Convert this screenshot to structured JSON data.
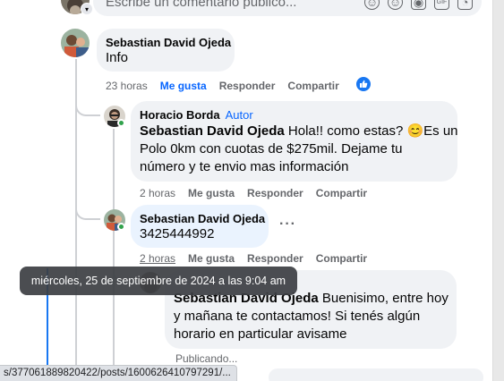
{
  "composer": {
    "placeholder": "Escribe un comentario público..."
  },
  "comments": [
    {
      "author": "Sebastian David Ojeda",
      "text": "Info",
      "time": "23 horas",
      "like_label": "Me gusta",
      "reply_label": "Responder",
      "share_label": "Compartir"
    },
    {
      "author": "Horacio Borda",
      "author_badge": "Autor",
      "mention": "Sebastian David Ojeda",
      "text_l1": " Hola!! como estas? ",
      "emoji": "😊",
      "text_l1b": "Es un",
      "text_l2": "Polo 0km con cuotas de $275mil. Dejame tu",
      "text_l3": "número y te envio mas información",
      "time": "2 horas",
      "like_label": "Me gusta",
      "reply_label": "Responder",
      "share_label": "Compartir"
    },
    {
      "author": "Sebastian David Ojeda",
      "text": "3425444992",
      "time": "2 horas",
      "like_label": "Me gusta",
      "reply_label": "Responder",
      "share_label": "Compartir"
    },
    {
      "mention": "Sebastian David Ojeda",
      "text_l1": " Buenisimo, entre hoy",
      "text_l2": "y mañana te contactamos! Si tenés algún",
      "text_l3": "horario en particular avisame",
      "status": "Publicando..."
    }
  ],
  "tooltip": "miércoles, 25 de septiembre de 2024 a las 9:04 am",
  "status_url": "s/377061889820422/posts/1600626410797291/...",
  "colors": {
    "accent": "#0866ff",
    "bubble": "#f0f2f5",
    "bubble_hover": "#eaf3fe",
    "tooltip_bg": "#3c3e42",
    "like_badge": "#1877f2"
  }
}
